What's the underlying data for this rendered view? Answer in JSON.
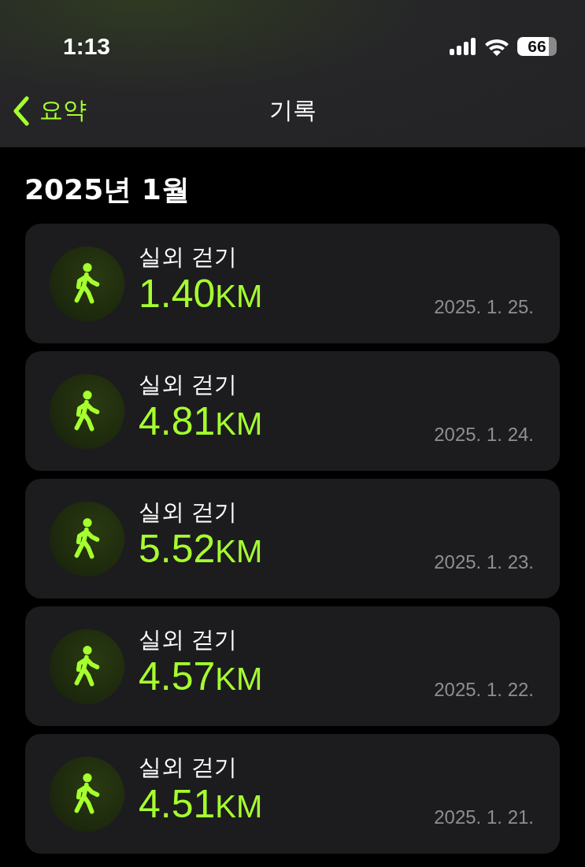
{
  "status_bar": {
    "time": "1:13",
    "battery": "66"
  },
  "nav": {
    "back": "요약",
    "title": "기록"
  },
  "section": {
    "title": "2025년 1월"
  },
  "workouts": [
    {
      "name": "실외 걷기",
      "distance": "1.40",
      "unit": "KM",
      "date": "2025. 1. 25."
    },
    {
      "name": "실외 걷기",
      "distance": "4.81",
      "unit": "KM",
      "date": "2025. 1. 24."
    },
    {
      "name": "실외 걷기",
      "distance": "5.52",
      "unit": "KM",
      "date": "2025. 1. 23."
    },
    {
      "name": "실외 걷기",
      "distance": "4.57",
      "unit": "KM",
      "date": "2025. 1. 22."
    },
    {
      "name": "실외 걷기",
      "distance": "4.51",
      "unit": "KM",
      "date": "2025. 1. 21."
    }
  ]
}
